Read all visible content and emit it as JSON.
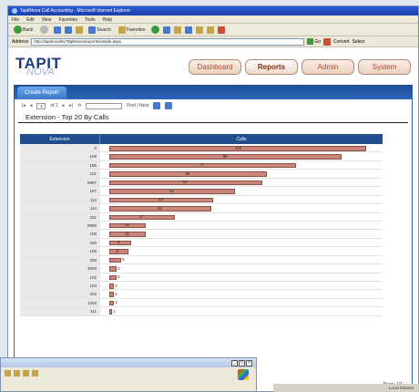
{
  "browser": {
    "title": "TapitNova Call Accounting - Microsoft Internet Explorer",
    "menu": [
      "File",
      "Edit",
      "View",
      "Favorites",
      "Tools",
      "Help"
    ],
    "toolbar": {
      "back": "Back",
      "search": "Search",
      "favorites": "Favorites"
    },
    "address_label": "Address",
    "address_value": "http://tapitnovdev/TapitNova/reports/simple.aspx",
    "go_label": "Go",
    "convert_label": "Convert",
    "select_label": "Select",
    "status_text": "Local intranet"
  },
  "app": {
    "logo_line1": "TAPIT",
    "logo_line2": "NOVA",
    "nav": [
      "Dashboard",
      "Reports",
      "Admin",
      "System"
    ],
    "active_nav": "Reports",
    "subtab": "Create Report"
  },
  "report": {
    "toolbar": {
      "page_value": "1",
      "of_label": "of 1",
      "find_label": "Find | Next"
    },
    "title": "Extension - Top 20 By Calls",
    "col_extension": "Extension",
    "col_calls": "Calls",
    "page_label": "Page: 1/1"
  },
  "chart_data": {
    "type": "bar",
    "title": "Extension - Top 20 By Calls",
    "xlabel": "Calls",
    "ylabel": "Extension",
    "categories": [
      "0",
      "109",
      "185",
      "101",
      "9997",
      "187",
      "112",
      "114",
      "201",
      "9999",
      "106",
      "200",
      "105",
      "300",
      "3000",
      "102",
      "104",
      "202",
      "1000",
      "411"
    ],
    "values": [
      106,
      96,
      77,
      65,
      63,
      52,
      43,
      42,
      27,
      15,
      15,
      9,
      8,
      5,
      3,
      3,
      2,
      2,
      2,
      1
    ],
    "xlim": [
      0,
      106
    ]
  }
}
